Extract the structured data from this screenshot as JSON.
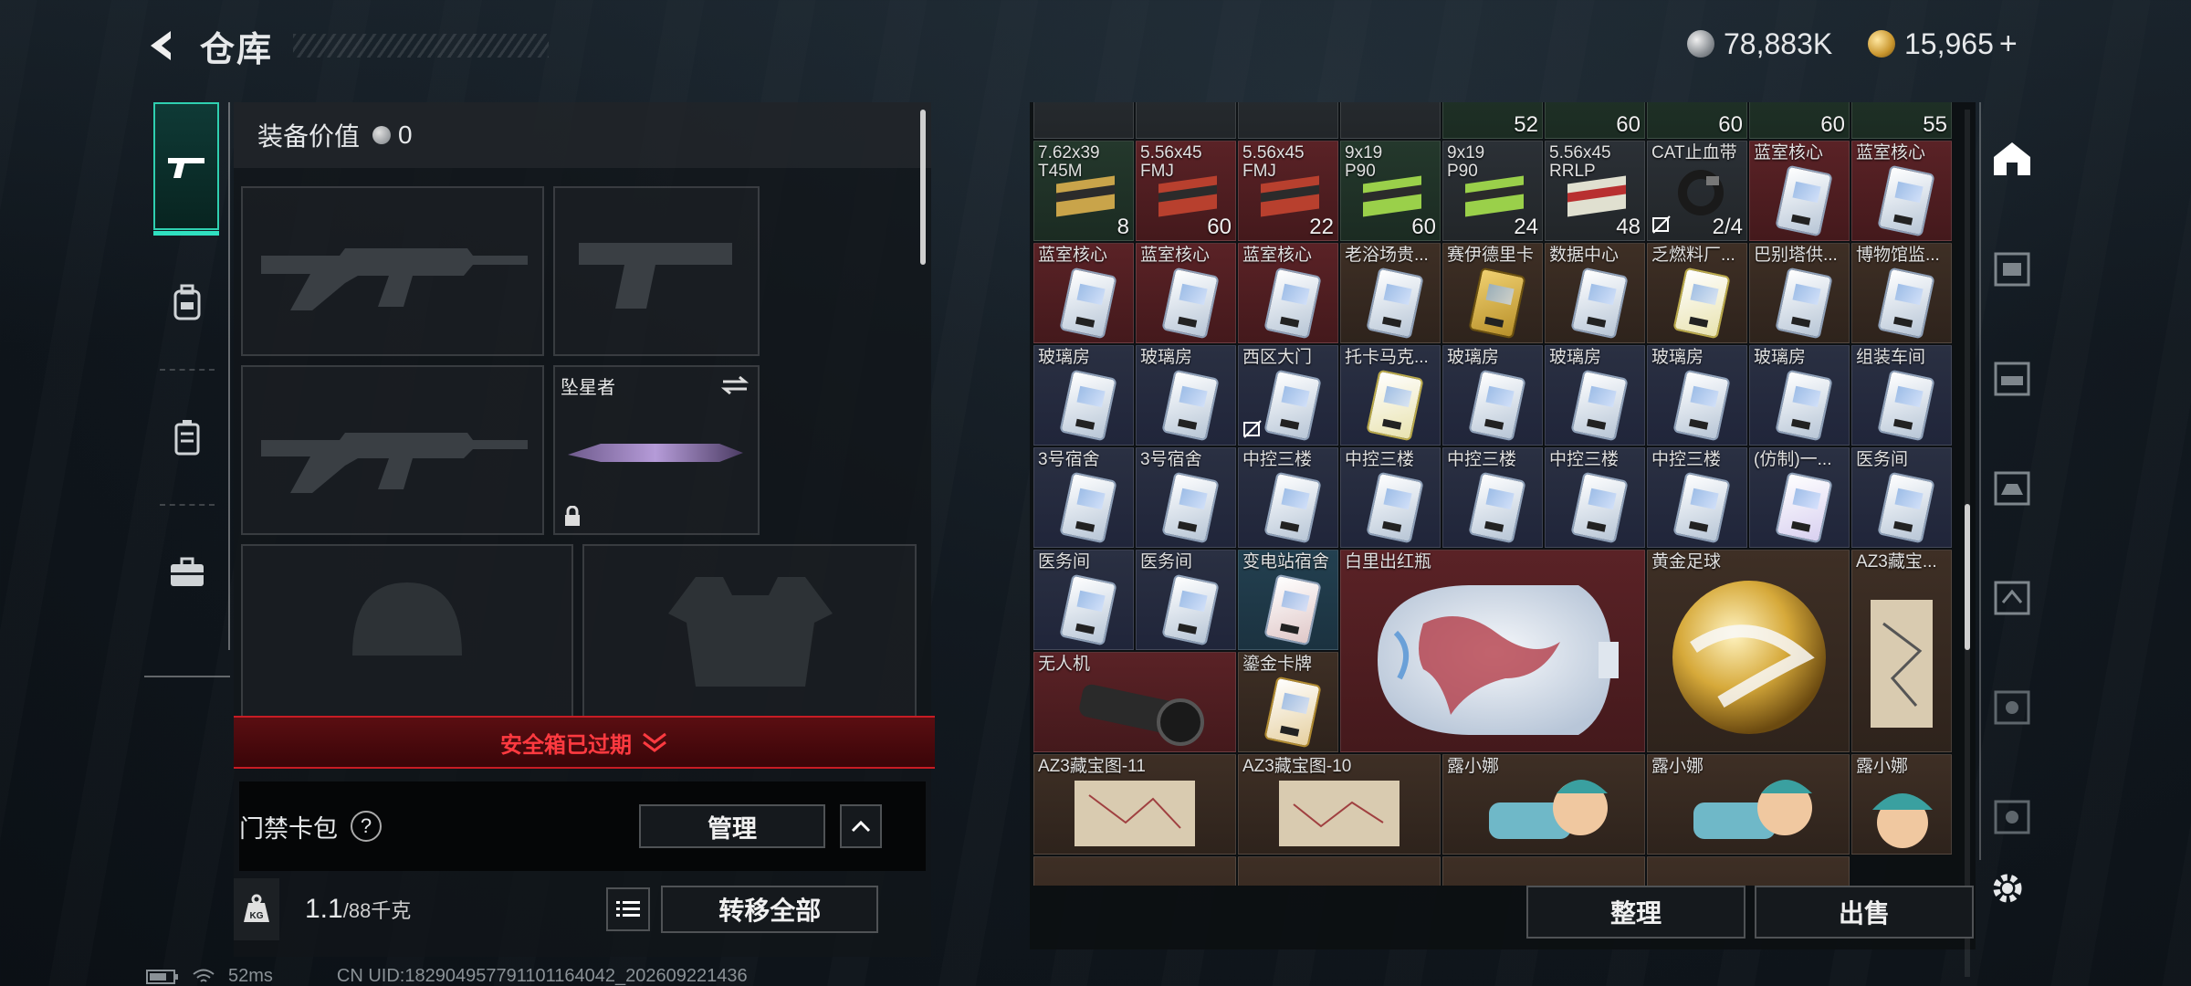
{
  "header": {
    "title": "仓库",
    "currency_silver": "78,883K",
    "currency_gold": "15,965",
    "gold_plus": "+"
  },
  "equipment": {
    "value_label": "装备价值",
    "value": "0",
    "melee_name": "坠星者"
  },
  "safe_box": {
    "expired_text": "安全箱已过期"
  },
  "card_pack": {
    "label": "门禁卡包",
    "help": "?",
    "manage_label": "管理"
  },
  "weight": {
    "current": "1.1",
    "max": "/88千克"
  },
  "transfer_all_label": "转移全部",
  "stash": {
    "sort_label": "整理",
    "sell_label": "出售",
    "top_counts": [
      "52",
      "60",
      "60",
      "60",
      "55"
    ],
    "row1": [
      {
        "l1": "7.62x39",
        "l2": "T45M",
        "count": "8"
      },
      {
        "l1": "5.56x45",
        "l2": "FMJ",
        "count": "60"
      },
      {
        "l1": "5.56x45",
        "l2": "FMJ",
        "count": "22"
      },
      {
        "l1": "9x19",
        "l2": "P90",
        "count": "60"
      },
      {
        "l1": "9x19",
        "l2": "P90",
        "count": "24"
      },
      {
        "l1": "5.56x45",
        "l2": "RRLP",
        "count": "48"
      },
      {
        "l1": "CAT止血带",
        "l2": "",
        "count": "2/4"
      },
      {
        "l1": "蓝室核心",
        "l2": "",
        "count": ""
      },
      {
        "l1": "蓝室核心",
        "l2": "",
        "count": ""
      }
    ],
    "row2": [
      "蓝室核心",
      "蓝室核心",
      "蓝室核心",
      "老浴场贵...",
      "赛伊德里卡",
      "数据中心",
      "乏燃料厂...",
      "巴别塔供...",
      "博物馆监..."
    ],
    "row3": [
      "玻璃房",
      "玻璃房",
      "西区大门",
      "托卡马克...",
      "玻璃房",
      "玻璃房",
      "玻璃房",
      "玻璃房",
      "组装车间"
    ],
    "row4": [
      "3号宿舍",
      "3号宿舍",
      "中控三楼",
      "中控三楼",
      "中控三楼",
      "中控三楼",
      "中控三楼",
      "(仿制)一...",
      "医务间"
    ],
    "row5a": [
      "医务间",
      "医务间",
      "变电站宿舍"
    ],
    "vase": "白里出红瓶",
    "ball": "黄金足球",
    "az3_right": "AZ3藏宝...",
    "drone": "无人机",
    "goldcard": "鎏金卡牌",
    "az3_a": "AZ3藏宝图-11",
    "az3_b": "AZ3藏宝图-10",
    "lu1": "露小娜",
    "lu2": "露小娜",
    "lu3": "露小娜"
  },
  "status": {
    "ping": "52ms",
    "uid": "CN UID:18290495779110116404​2_202609221436"
  },
  "colors": {
    "accent": "#2fd0b0",
    "danger": "#c71c24",
    "red_cell": "#5a2226",
    "blue_cell": "#2a3042"
  }
}
